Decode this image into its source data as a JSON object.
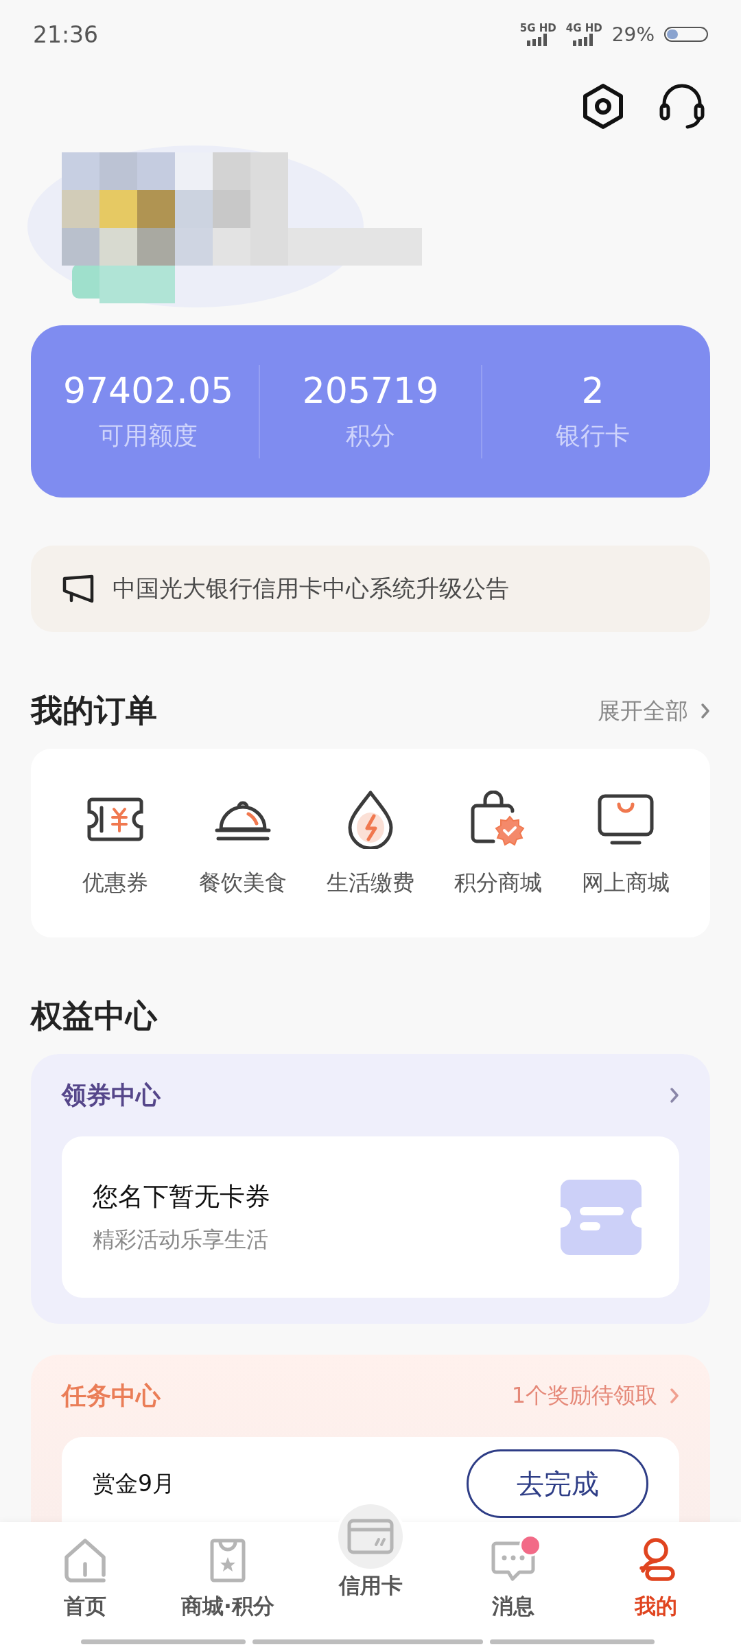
{
  "status_bar": {
    "time": "21:36",
    "network_1": "5G HD",
    "network_2": "4G HD",
    "battery": "29%"
  },
  "stats": [
    {
      "value": "97402.05",
      "label": "可用额度"
    },
    {
      "value": "205719",
      "label": "积分"
    },
    {
      "value": "2",
      "label": "银行卡"
    }
  ],
  "notice": {
    "text": "中国光大银行信用卡中心系统升级公告"
  },
  "orders": {
    "title": "我的订单",
    "more": "展开全部",
    "items": [
      {
        "label": "优惠券",
        "kind": "ticket"
      },
      {
        "label": "餐饮美食",
        "kind": "cloche"
      },
      {
        "label": "生活缴费",
        "kind": "drop"
      },
      {
        "label": "积分商城",
        "kind": "bag"
      },
      {
        "label": "网上商城",
        "kind": "monitor"
      }
    ]
  },
  "benefits": {
    "title": "权益中心",
    "coupons": {
      "title": "领券中心",
      "empty_title": "您名下暂无卡券",
      "empty_subtitle": "精彩活动乐享生活"
    },
    "tasks": {
      "title": "任务中心",
      "reward": "1个奖励待领取",
      "items": [
        {
          "title": "赏金9月",
          "action": "去完成"
        }
      ]
    }
  },
  "nav": [
    {
      "label": "首页",
      "kind": "home",
      "selected": false,
      "badge": false
    },
    {
      "label": "商城·积分",
      "kind": "shop",
      "selected": false,
      "badge": false
    },
    {
      "label": "信用卡",
      "kind": "card",
      "selected": false,
      "badge": false
    },
    {
      "label": "消息",
      "kind": "chat",
      "selected": false,
      "badge": true
    },
    {
      "label": "我的",
      "kind": "user",
      "selected": true,
      "badge": false
    }
  ]
}
